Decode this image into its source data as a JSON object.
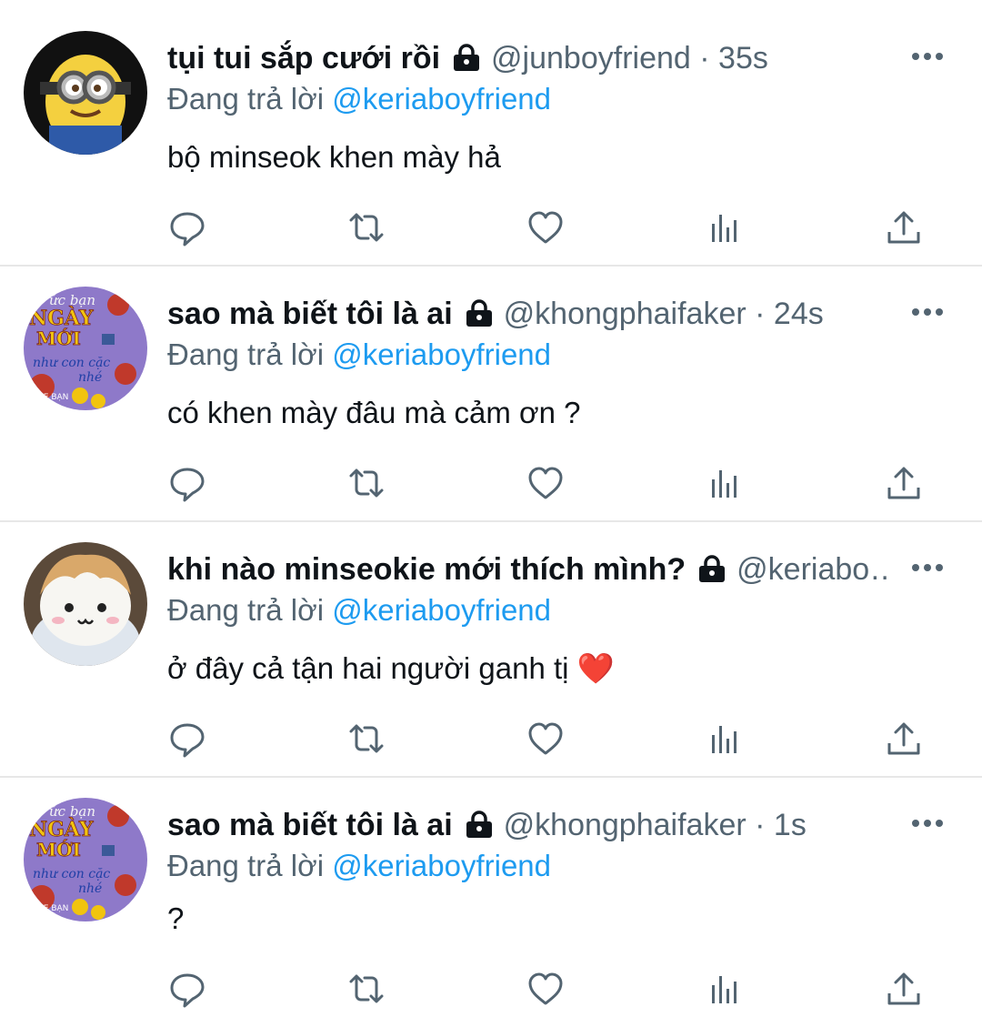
{
  "tweets": [
    {
      "name": "tụi tui sắp cưới rồi",
      "handle": "@junboyfriend",
      "separator": "·",
      "time": "35s",
      "reply_prefix": "Đang trả lời",
      "reply_to": "@keriaboyfriend",
      "text": "bộ minseok khen mày hả",
      "avatar_icon": "minion-avatar"
    },
    {
      "name": "sao mà biết tôi là ai",
      "handle": "@khongphaifaker",
      "separator": "·",
      "time": "24s",
      "reply_prefix": "Đang trả lời",
      "reply_to": "@keriaboyfriend",
      "text": "có khen mày đâu mà cảm ơn ?",
      "avatar_icon": "flower-greeting-avatar",
      "avatar_text": [
        "ức bạn",
        "NGÀY",
        "MỚI",
        "như con cặc",
        "nhé",
        "ME BẠN"
      ]
    },
    {
      "name": "khi nào minseokie mới thích mình?",
      "handle": "@keriabo…",
      "separator": "",
      "time": "",
      "reply_prefix": "Đang trả lời",
      "reply_to": "@keriaboyfriend",
      "text": "ở đây cả tận hai người ganh tị ❤️",
      "avatar_icon": "plush-doll-avatar"
    },
    {
      "name": "sao mà biết tôi là ai",
      "handle": "@khongphaifaker",
      "separator": "·",
      "time": "1s",
      "reply_prefix": "Đang trả lời",
      "reply_to": "@keriaboyfriend",
      "text": "?",
      "avatar_icon": "flower-greeting-avatar",
      "avatar_text": [
        "ức bạn",
        "NGÀY",
        "MỚI",
        "như con cặc",
        "nhé",
        "ME BẠN"
      ]
    }
  ],
  "action_icons": [
    "reply-icon",
    "retweet-icon",
    "like-icon",
    "analytics-icon",
    "share-icon"
  ],
  "colors": {
    "link": "#1d9bf0",
    "secondary": "#536471",
    "icon": "#536471",
    "divider": "#e7e7e7"
  }
}
